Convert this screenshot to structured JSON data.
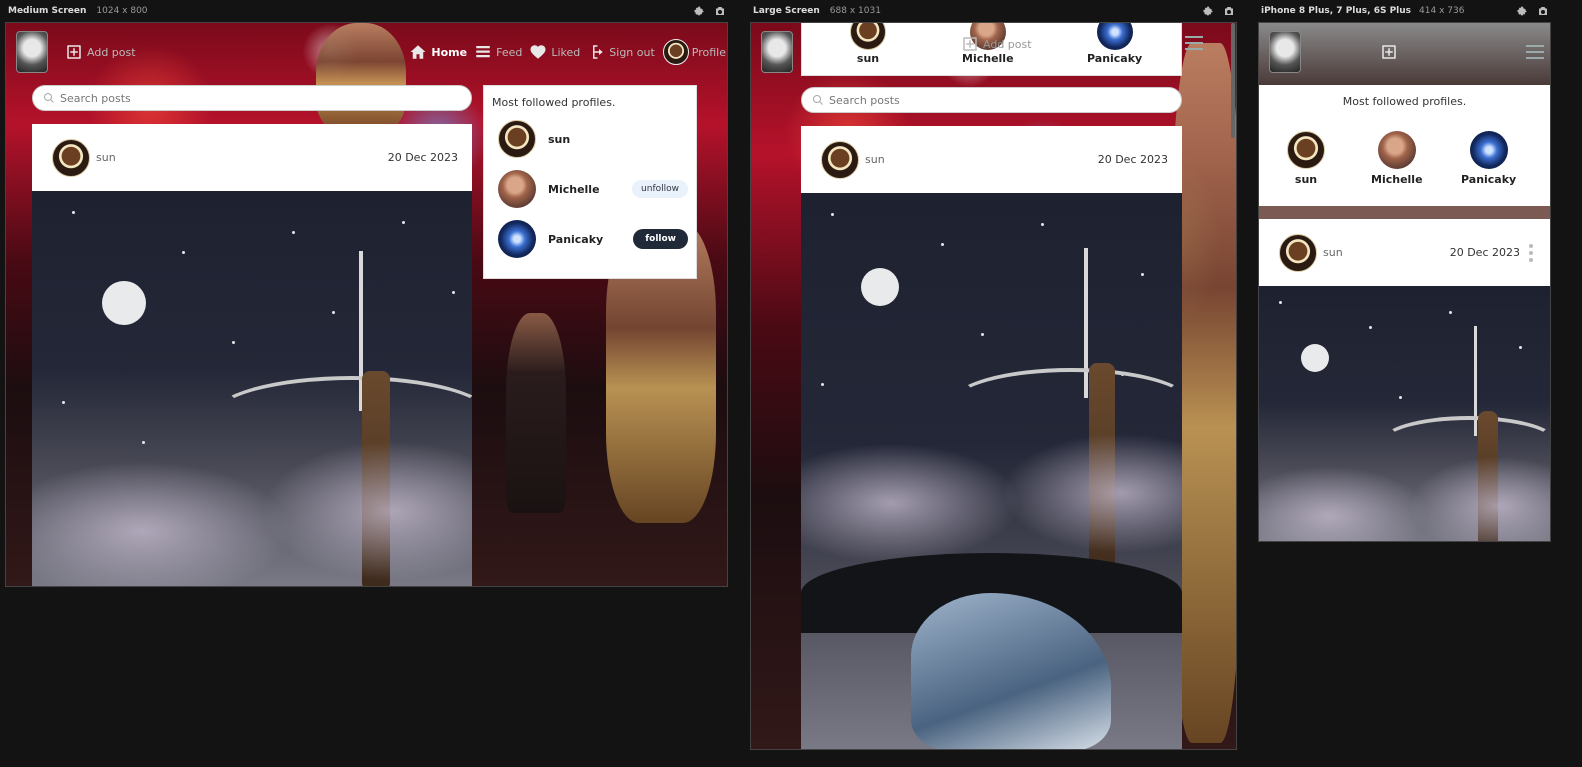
{
  "panels": [
    {
      "title": "Medium Screen",
      "dims": "1024 x 800"
    },
    {
      "title": "Large Screen",
      "dims": "688 x 1031"
    },
    {
      "title": "iPhone 8 Plus, 7 Plus, 6S Plus",
      "dims": "414 x 736"
    }
  ],
  "icons": {
    "settings": "gear-icon",
    "capture": "camera-icon",
    "add_post": "plus-square-icon",
    "home": "home-icon",
    "feed": "stream-icon",
    "liked": "heart-icon",
    "sign_out": "sign-out-icon",
    "search": "search-icon",
    "menu": "hamburger-icon",
    "more": "more-vertical-icon"
  },
  "nav": {
    "add_post": "Add post",
    "home": "Home",
    "feed": "Feed",
    "liked": "Liked",
    "sign_out": "Sign out",
    "profile": "Profile"
  },
  "search": {
    "placeholder": "Search posts"
  },
  "post": {
    "author": "sun",
    "date": "20 Dec 2023"
  },
  "most_followed": {
    "title": "Most followed profiles.",
    "profiles": [
      {
        "name": "sun",
        "action": ""
      },
      {
        "name": "Michelle",
        "action": "unfollow"
      },
      {
        "name": "Panicaky",
        "action": "follow"
      }
    ]
  },
  "colors": {
    "follow_button": "#1f2937",
    "unfollow_button": "#e9f1fb",
    "page_background": "#131313"
  }
}
